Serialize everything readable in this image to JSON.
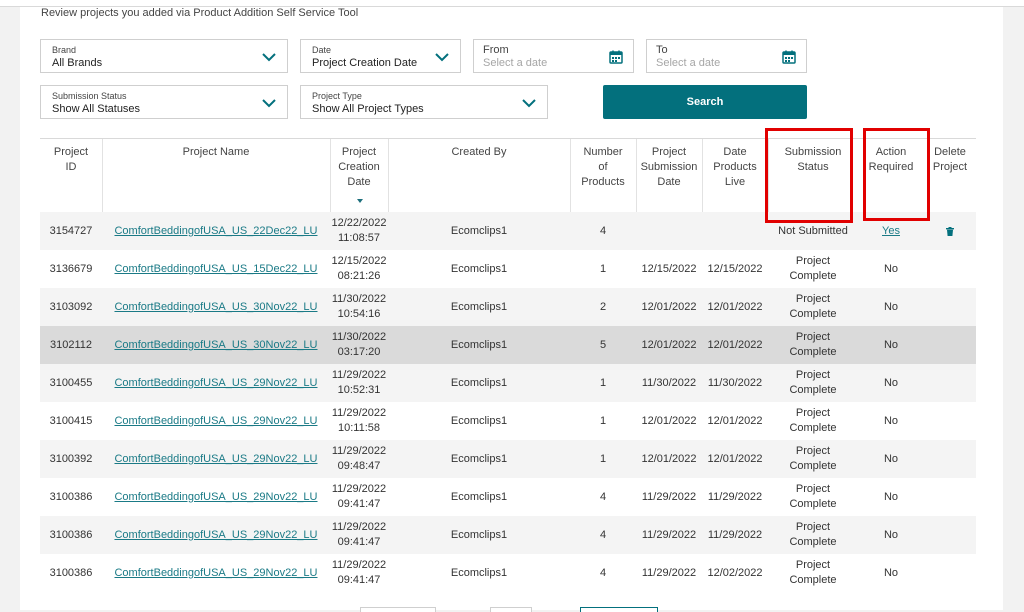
{
  "header": {
    "subtitle": "Review projects you added via Product Addition Self Service Tool"
  },
  "filters": {
    "brand": {
      "label": "Brand",
      "value": "All Brands"
    },
    "date": {
      "label": "Date",
      "value": "Project Creation Date"
    },
    "from": {
      "label": "From",
      "placeholder": "Select a date"
    },
    "to": {
      "label": "To",
      "placeholder": "Select a date"
    },
    "submission_status": {
      "label": "Submission Status",
      "value": "Show All Statuses"
    },
    "project_type": {
      "label": "Project Type",
      "value": "Show All Project Types"
    },
    "search_label": "Search"
  },
  "colors": {
    "accent": "#03707d",
    "link": "#1a7a86",
    "highlight": "#e10000"
  },
  "table": {
    "columns": [
      "Project ID",
      "Project Name",
      "Project Creation Date",
      "Created By",
      "Number of Products",
      "Project Submission Date",
      "Date Products Live",
      "Submission Status",
      "Action Required",
      "Delete Project"
    ],
    "column_lines": [
      [
        "Project",
        "ID"
      ],
      [
        "Project Name"
      ],
      [
        "Project",
        "Creation",
        "Date"
      ],
      [
        "Created By"
      ],
      [
        "Number",
        "of",
        "Products"
      ],
      [
        "Project",
        "Submission",
        "Date"
      ],
      [
        "Date",
        "Products",
        "Live"
      ],
      [
        "Submission",
        "Status"
      ],
      [
        "Action",
        "Required"
      ],
      [
        "Delete",
        "Project"
      ]
    ],
    "rows": [
      {
        "id": "3154727",
        "name": "ComfortBeddingofUSA_US_22Dec22_LU",
        "created_date": "12/22/2022",
        "created_time": "11:08:57",
        "created_by": "Ecomclips1",
        "products": "4",
        "submission_date": "",
        "live_date": "",
        "status": [
          "Not Submitted"
        ],
        "action": "Yes",
        "delete_icon": "trash-icon"
      },
      {
        "id": "3136679",
        "name": "ComfortBeddingofUSA_US_15Dec22_LU",
        "created_date": "12/15/2022",
        "created_time": "08:21:26",
        "created_by": "Ecomclips1",
        "products": "1",
        "submission_date": "12/15/2022",
        "live_date": "12/15/2022",
        "status": [
          "Project",
          "Complete"
        ],
        "action": "No"
      },
      {
        "id": "3103092",
        "name": "ComfortBeddingofUSA_US_30Nov22_LU",
        "created_date": "11/30/2022",
        "created_time": "10:54:16",
        "created_by": "Ecomclips1",
        "products": "2",
        "submission_date": "12/01/2022",
        "live_date": "12/01/2022",
        "status": [
          "Project",
          "Complete"
        ],
        "action": "No"
      },
      {
        "id": "3102112",
        "name": "ComfortBeddingofUSA_US_30Nov22_LU",
        "created_date": "11/30/2022",
        "created_time": "03:17:20",
        "created_by": "Ecomclips1",
        "products": "5",
        "submission_date": "12/01/2022",
        "live_date": "12/01/2022",
        "status": [
          "Project",
          "Complete"
        ],
        "action": "No"
      },
      {
        "id": "3100455",
        "name": "ComfortBeddingofUSA_US_29Nov22_LU",
        "created_date": "11/29/2022",
        "created_time": "10:52:31",
        "created_by": "Ecomclips1",
        "products": "1",
        "submission_date": "11/30/2022",
        "live_date": "11/30/2022",
        "status": [
          "Project",
          "Complete"
        ],
        "action": "No"
      },
      {
        "id": "3100415",
        "name": "ComfortBeddingofUSA_US_29Nov22_LU",
        "created_date": "11/29/2022",
        "created_time": "10:11:58",
        "created_by": "Ecomclips1",
        "products": "1",
        "submission_date": "12/01/2022",
        "live_date": "12/01/2022",
        "status": [
          "Project",
          "Complete"
        ],
        "action": "No"
      },
      {
        "id": "3100392",
        "name": "ComfortBeddingofUSA_US_29Nov22_LU",
        "created_date": "11/29/2022",
        "created_time": "09:48:47",
        "created_by": "Ecomclips1",
        "products": "1",
        "submission_date": "12/01/2022",
        "live_date": "12/01/2022",
        "status": [
          "Project",
          "Complete"
        ],
        "action": "No"
      },
      {
        "id": "3100386",
        "name": "ComfortBeddingofUSA_US_29Nov22_LU",
        "created_date": "11/29/2022",
        "created_time": "09:41:47",
        "created_by": "Ecomclips1",
        "products": "4",
        "submission_date": "11/29/2022",
        "live_date": "11/29/2022",
        "status": [
          "Project",
          "Complete"
        ],
        "action": "No"
      },
      {
        "id": "3100386",
        "name": "ComfortBeddingofUSA_US_29Nov22_LU",
        "created_date": "11/29/2022",
        "created_time": "09:41:47",
        "created_by": "Ecomclips1",
        "products": "4",
        "submission_date": "11/29/2022",
        "live_date": "11/29/2022",
        "status": [
          "Project",
          "Complete"
        ],
        "action": "No"
      },
      {
        "id": "3100386",
        "name": "ComfortBeddingofUSA_US_29Nov22_LU",
        "created_date": "11/29/2022",
        "created_time": "09:41:47",
        "created_by": "Ecomclips1",
        "products": "4",
        "submission_date": "11/29/2022",
        "live_date": "12/02/2022",
        "status": [
          "Project",
          "Complete"
        ],
        "action": "No"
      }
    ]
  }
}
